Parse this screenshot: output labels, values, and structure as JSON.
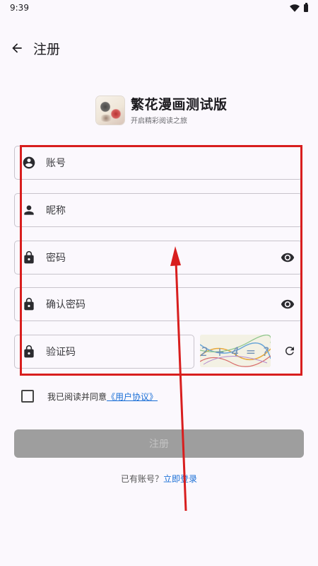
{
  "status_bar": {
    "time": "9:39"
  },
  "app_bar": {
    "title": "注册"
  },
  "brand": {
    "name": "繁花漫画测试版",
    "slogan": "开启精彩阅读之旅"
  },
  "form": {
    "account_placeholder": "账号",
    "nickname_placeholder": "昵称",
    "password_placeholder": "密码",
    "confirm_password_placeholder": "确认密码",
    "captcha_placeholder": "验证码",
    "captcha_text": "2 + 4 = ?"
  },
  "agreement": {
    "text": "我已阅读并同意",
    "link": "《用户协议》",
    "checked": false
  },
  "submit": {
    "label": "注册",
    "enabled": false
  },
  "login": {
    "prompt": "已有账号？",
    "link": "立即登录"
  },
  "colors": {
    "accent": "#1a6fd6",
    "annotation": "#d81e1e",
    "disabled_button": "#9e9e9e"
  }
}
